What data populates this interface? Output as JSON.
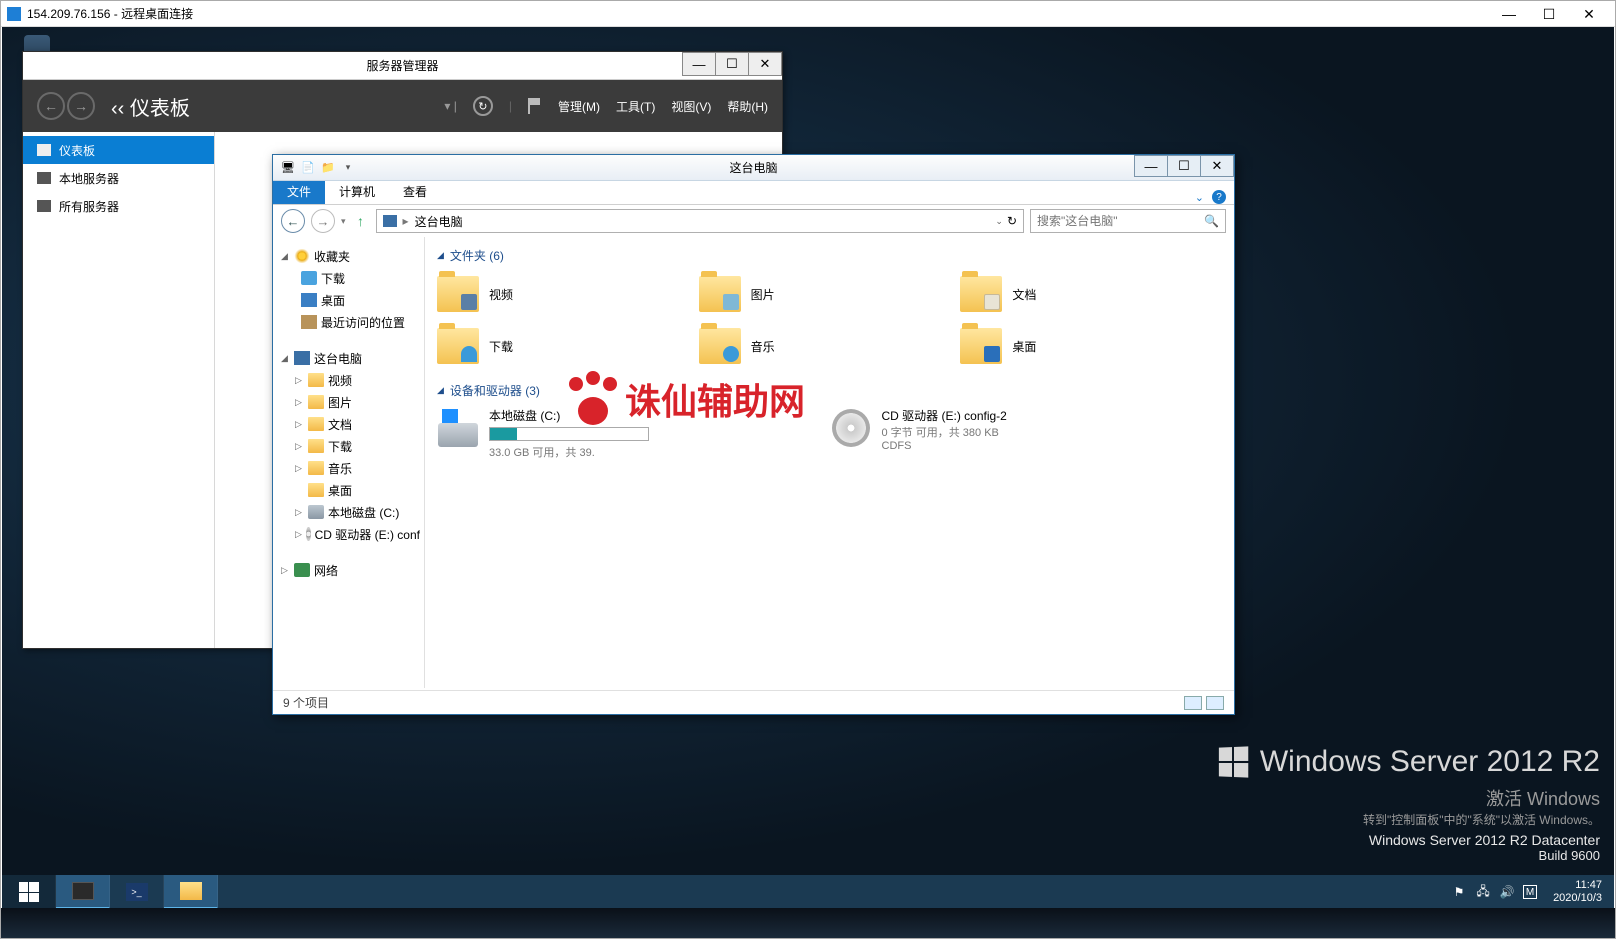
{
  "rdp": {
    "title": "154.209.76.156 - 远程桌面连接"
  },
  "server_manager": {
    "title": "服务器管理器",
    "breadcrumb": "‹‹ 仪表板",
    "menu": {
      "manage": "管理(M)",
      "tools": "工具(T)",
      "view": "视图(V)",
      "help": "帮助(H)"
    },
    "sidebar": {
      "dashboard": "仪表板",
      "local": "本地服务器",
      "all": "所有服务器"
    }
  },
  "explorer": {
    "title": "这台电脑",
    "tabs": {
      "file": "文件",
      "computer": "计算机",
      "view": "查看"
    },
    "breadcrumb": "这台电脑",
    "search_placeholder": "搜索\"这台电脑\"",
    "tree": {
      "favorites": "收藏夹",
      "fav": {
        "downloads": "下载",
        "desktop": "桌面",
        "recent": "最近访问的位置"
      },
      "this_pc": "这台电脑",
      "pc": {
        "videos": "视频",
        "pictures": "图片",
        "documents": "文档",
        "downloads": "下载",
        "music": "音乐",
        "desktop": "桌面",
        "localdisk": "本地磁盘 (C:)",
        "cddrive": "CD 驱动器 (E:) conf"
      },
      "network": "网络"
    },
    "sections": {
      "folders": "文件夹 (6)",
      "drives": "设备和驱动器 (3)"
    },
    "folders": {
      "videos": "视频",
      "pictures": "图片",
      "documents": "文档",
      "downloads": "下载",
      "music": "音乐",
      "desktop": "桌面"
    },
    "drives": {
      "c": {
        "name": "本地磁盘 (C:)",
        "meta": "33.0 GB 可用，共 39."
      },
      "e": {
        "name": "CD 驱动器 (E:) config-2",
        "line2": "0 字节 可用，共 380 KB",
        "line3": "CDFS"
      }
    },
    "status": "9 个项目"
  },
  "watermark": "诛仙辅助网",
  "branding": {
    "product": "Windows Server 2012 R2",
    "activate_title": "激活 Windows",
    "activate_sub": "转到\"控制面板\"中的\"系统\"以激活 Windows。",
    "datacenter": "Windows Server 2012 R2 Datacenter",
    "build": "Build 9600"
  },
  "taskbar": {
    "ime": "M",
    "time": "11:47",
    "date": "2020/10/3"
  }
}
